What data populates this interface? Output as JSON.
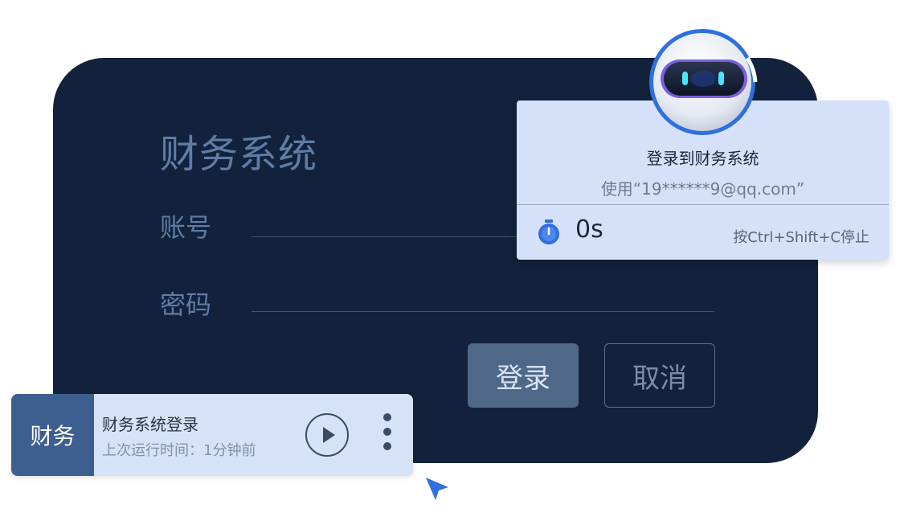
{
  "login": {
    "title": "财务系统",
    "account_label": "账号",
    "password_label": "密码",
    "login_button": "登录",
    "cancel_button": "取消"
  },
  "task_card": {
    "badge": "财务",
    "name": "财务系统登录",
    "last_run": "上次运行时间：1分钟前"
  },
  "recorder": {
    "title": "登录到财务系统",
    "subtitle": "使用“19******9@qq.com”",
    "timer": "0s",
    "hint": "按Ctrl+Shift+C停止"
  },
  "icons": {
    "robot": "robot-avatar-icon",
    "timer": "stopwatch-icon",
    "play": "play-icon",
    "more": "more-vertical-icon",
    "cursor": "mouse-cursor-icon"
  },
  "colors": {
    "panel_bg": "#13223c",
    "accent": "#2f6fe0",
    "popup_bg": "#d4e1f8",
    "badge_bg": "#3d5f8f"
  }
}
